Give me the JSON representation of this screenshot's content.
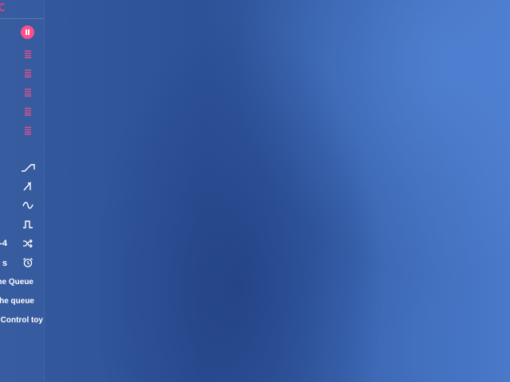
{
  "brand": {
    "logo_text": "C"
  },
  "colors": {
    "accent": "#ff4f8a",
    "icon": "#ffffff",
    "background": "#3561a8"
  },
  "controls": {
    "pause_icon": "pause-icon",
    "list_icons": [
      "list-icon",
      "list-icon",
      "list-icon",
      "list-icon",
      "list-icon"
    ],
    "patterns": [
      {
        "icon": "ramp-up-icon",
        "label": ""
      },
      {
        "icon": "saw-up-icon",
        "label": ""
      },
      {
        "icon": "sine-wave-icon",
        "label": ""
      },
      {
        "icon": "square-wave-icon",
        "label": ""
      },
      {
        "icon": "shuffle-icon",
        "label": "-4"
      },
      {
        "icon": "alarm-clock-icon",
        "label": "s"
      }
    ]
  },
  "menu": {
    "item1": "he Queue",
    "item2": "he queue",
    "item3": "Control toy"
  }
}
